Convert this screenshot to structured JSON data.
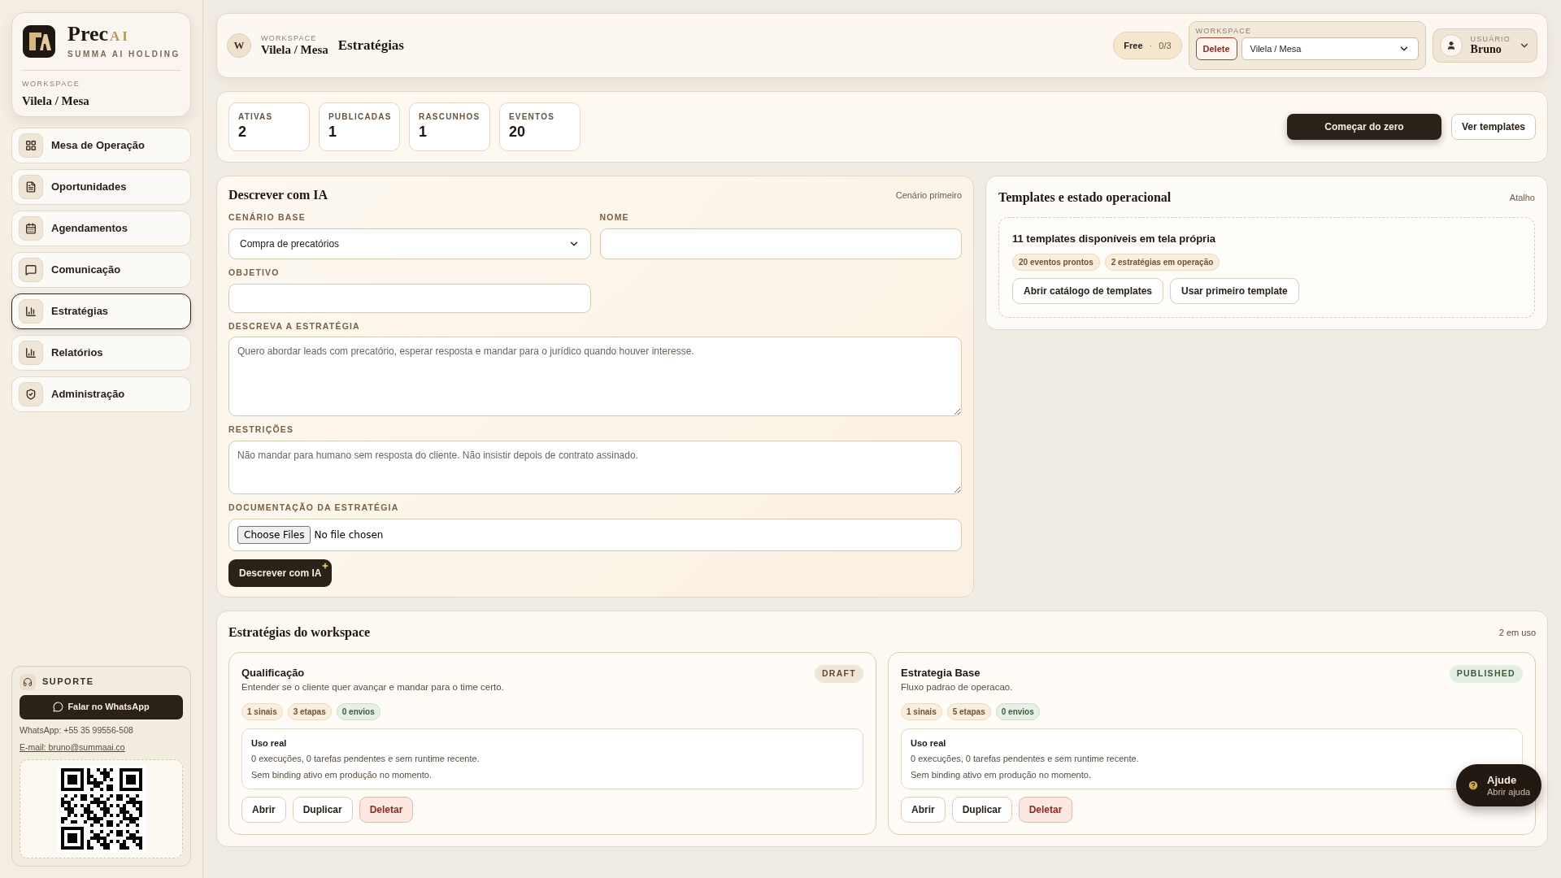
{
  "sidebar": {
    "brand": {
      "name": "Prec",
      "accent": "AI",
      "subtitle": "SUMMA AI HOLDING"
    },
    "workspace_label": "WORKSPACE",
    "workspace_name": "Vilela / Mesa",
    "nav": [
      {
        "label": "Mesa de Operação",
        "selected": false
      },
      {
        "label": "Oportunidades",
        "selected": false
      },
      {
        "label": "Agendamentos",
        "selected": false
      },
      {
        "label": "Comunicação",
        "selected": false
      },
      {
        "label": "Estratégias",
        "selected": true
      },
      {
        "label": "Relatórios",
        "selected": false
      },
      {
        "label": "Administração",
        "selected": false
      }
    ],
    "support": {
      "title": "SUPORTE",
      "button": "Falar no WhatsApp",
      "phone": "WhatsApp: +55 35 99556-508",
      "email": "E-mail: bruno@summaai.co"
    }
  },
  "header": {
    "avatar": "W",
    "workspace_label": "WORKSPACE",
    "workspace_name": "Vilela / Mesa",
    "title": "Estratégias",
    "plan": "Free",
    "plan_separator": "·",
    "plan_usage": "0/3",
    "workspace_picker": {
      "label": "WORKSPACE",
      "delete_button": "Delete",
      "value": "Vilela / Mesa"
    },
    "user": {
      "label": "USUÁRIO",
      "name": "Bruno"
    }
  },
  "stats": [
    {
      "label": "ATIVAS",
      "value": "2"
    },
    {
      "label": "PUBLICADAS",
      "value": "1"
    },
    {
      "label": "RASCUNHOS",
      "value": "1"
    },
    {
      "label": "EVENTOS",
      "value": "20"
    }
  ],
  "actions": [
    {
      "label": "Começar do zero",
      "kind": "primary"
    },
    {
      "label": "Ver templates",
      "kind": "secondary"
    }
  ],
  "describe": {
    "title": "Descrever com IA",
    "hint": "Cenário primeiro",
    "scenario": {
      "label": "CENÁRIO BASE",
      "value": "Compra de precatórios"
    },
    "name": {
      "label": "NOME"
    },
    "objective": {
      "label": "OBJETIVO"
    },
    "strategy": {
      "label": "DESCREVA A ESTRATÉGIA",
      "placeholder": "Quero abordar leads com precatório, esperar resposta e mandar para o jurídico quando houver interesse."
    },
    "restrictions": {
      "label": "RESTRIÇÕES",
      "placeholder": "Não mandar para humano sem resposta do cliente. Não insistir depois de contrato assinado."
    },
    "documentation": {
      "label": "DOCUMENTAÇÃO DA ESTRATÉGIA",
      "button": "Choose Files",
      "status": "No file chosen"
    },
    "submit": "Descrever com IA"
  },
  "templates": {
    "title": "Templates e estado operacional",
    "hint": "Atalho",
    "heading": "11 templates disponíveis em tela própria",
    "chips": [
      "20 eventos prontos",
      "2 estratégias em operação"
    ],
    "buttons": [
      "Abrir catálogo de templates",
      "Usar primeiro template"
    ]
  },
  "strategies": {
    "title": "Estratégias do workspace",
    "count": "2 em uso",
    "items": [
      {
        "name": "Qualificação",
        "description": "Entender se o cliente quer avançar e mandar para o time certo.",
        "status": {
          "label": "DRAFT",
          "kind": "draft"
        },
        "chips": [
          {
            "label": "1 sinais",
            "kind": "neutral"
          },
          {
            "label": "3 etapas",
            "kind": "neutral"
          },
          {
            "label": "0 envios",
            "kind": "success"
          }
        ],
        "usage": {
          "title": "Uso real",
          "lines": [
            "0 execuções, 0 tarefas pendentes e sem runtime recente.",
            "Sem binding ativo em produção no momento."
          ]
        },
        "buttons": [
          {
            "label": "Abrir",
            "kind": "default"
          },
          {
            "label": "Duplicar",
            "kind": "default"
          },
          {
            "label": "Deletar",
            "kind": "danger"
          }
        ]
      },
      {
        "name": "Estrategia Base",
        "description": "Fluxo padrao de operacao.",
        "status": {
          "label": "PUBLISHED",
          "kind": "published"
        },
        "chips": [
          {
            "label": "1 sinais",
            "kind": "neutral"
          },
          {
            "label": "5 etapas",
            "kind": "neutral"
          },
          {
            "label": "0 envios",
            "kind": "success"
          }
        ],
        "usage": {
          "title": "Uso real",
          "lines": [
            "0 execuções, 0 tarefas pendentes e sem runtime recente.",
            "Sem binding ativo em produção no momento."
          ]
        },
        "buttons": [
          {
            "label": "Abrir",
            "kind": "default"
          },
          {
            "label": "Duplicar",
            "kind": "default"
          },
          {
            "label": "Deletar",
            "kind": "danger"
          }
        ]
      }
    ]
  },
  "help": {
    "title": "Ajude",
    "subtitle": "Abrir ajuda"
  }
}
